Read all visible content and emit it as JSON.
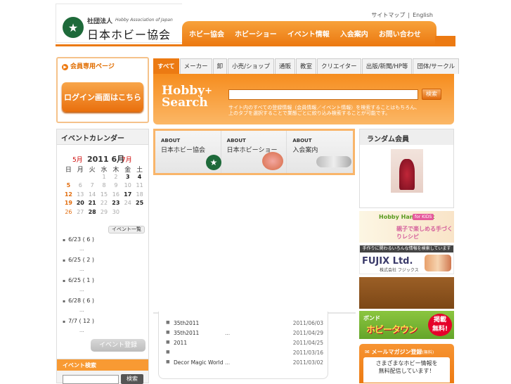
{
  "header": {
    "logo_sub": "社団法人",
    "logo_en": "Hobby Association of Japan",
    "logo_main": "日本ホビー協会",
    "utility": [
      "サイトマップ",
      "English"
    ],
    "nav": [
      "ホビー協会",
      "ホビーショー",
      "イベント情報",
      "入会案内",
      "お問い合わせ"
    ],
    "colors": {
      "accent": "#ec7a12",
      "brand_green": "#1e6a3a"
    }
  },
  "member": {
    "title": "会員専用ページ",
    "login_label": "ログイン画面はこちら"
  },
  "calendar": {
    "title": "イベントカレンダー",
    "prev": "5月",
    "current": "2011 6月",
    "next": "7月",
    "weekday_headers": [
      "日",
      "月",
      "火",
      "水",
      "木",
      "金",
      "土"
    ],
    "weeks": [
      [
        {
          "d": "",
          "s": ""
        },
        {
          "d": "",
          "s": ""
        },
        {
          "d": "",
          "s": ""
        },
        {
          "d": "1",
          "s": "off"
        },
        {
          "d": "2",
          "s": "off"
        },
        {
          "d": "3",
          "s": "on"
        },
        {
          "d": "4",
          "s": "on"
        }
      ],
      [
        {
          "d": "5",
          "s": "sun-on"
        },
        {
          "d": "6",
          "s": "off"
        },
        {
          "d": "7",
          "s": "off"
        },
        {
          "d": "8",
          "s": "off"
        },
        {
          "d": "9",
          "s": "off"
        },
        {
          "d": "10",
          "s": "off"
        },
        {
          "d": "11",
          "s": "off"
        }
      ],
      [
        {
          "d": "12",
          "s": "sun-on"
        },
        {
          "d": "13",
          "s": "off"
        },
        {
          "d": "14",
          "s": "off"
        },
        {
          "d": "15",
          "s": "off"
        },
        {
          "d": "16",
          "s": "off"
        },
        {
          "d": "17",
          "s": "on"
        },
        {
          "d": "18",
          "s": "off"
        }
      ],
      [
        {
          "d": "19",
          "s": "sun-on"
        },
        {
          "d": "20",
          "s": "on"
        },
        {
          "d": "21",
          "s": "on"
        },
        {
          "d": "22",
          "s": "off"
        },
        {
          "d": "23",
          "s": "on"
        },
        {
          "d": "24",
          "s": "off"
        },
        {
          "d": "25",
          "s": "on"
        }
      ],
      [
        {
          "d": "26",
          "s": "sun"
        },
        {
          "d": "27",
          "s": "off"
        },
        {
          "d": "28",
          "s": "on"
        },
        {
          "d": "29",
          "s": "off"
        },
        {
          "d": "30",
          "s": "off"
        },
        {
          "d": "",
          "s": ""
        },
        {
          "d": "",
          "s": ""
        }
      ]
    ],
    "list_button": "イベント一覧",
    "events": [
      {
        "date": "6/23 ( 6 )",
        "extra": "..."
      },
      {
        "date": "6/25 ( 2 )",
        "extra": "..."
      },
      {
        "date": "6/25 ( 1 )",
        "extra": "..."
      },
      {
        "date": "6/28 ( 6 )",
        "extra": "..."
      },
      {
        "date": "7/7 ( 12 )",
        "extra": "..."
      }
    ],
    "register_button": "イベント登録"
  },
  "event_search": {
    "title": "イベント検索",
    "input_value": "",
    "button": "検索"
  },
  "tabs": [
    "すべて",
    "メーカー",
    "卸",
    "小売/ショップ",
    "通販",
    "教室",
    "クリエイター",
    "出版/新聞/HP等",
    "団体/サークル"
  ],
  "hobby_search": {
    "logo1": "Hobby",
    "logo_plus": "+",
    "logo2": "Search",
    "input_value": "",
    "button": "検索",
    "desc1": "サイト内のすべての登録情報（会員情報／イベント情報）を検索することはもちろん、",
    "desc2": "上のタブを選択することで業態ごとに絞り込み検索することが可能です。"
  },
  "about": [
    {
      "t1": "ABOUT",
      "t2": "日本ホビー協会"
    },
    {
      "t1": "ABOUT",
      "t2": "日本ホビーショー"
    },
    {
      "t1": "ABOUT",
      "t2": "入会案内"
    }
  ],
  "news": [
    {
      "title": "35th2011",
      "extra": "",
      "date": "2011/06/03"
    },
    {
      "title": "35th2011",
      "extra": "...",
      "date": "2011/04/29"
    },
    {
      "title": "2011",
      "extra": "",
      "date": "2011/04/25"
    },
    {
      "title": "",
      "extra": "",
      "date": "2011/03/16"
    },
    {
      "title": "Decor Magic World",
      "extra": "...",
      "date": "2011/03/02"
    }
  ],
  "random": {
    "title": "ランダム会員"
  },
  "banners": {
    "hobby_title": "Hobby Handicraft",
    "hobby_kids": "for KIDS",
    "hobby_sub": "親子で楽しめる手づくりレシピ",
    "fujix_top": "手作りに関わるいろんな情報を検索しています",
    "fujix_name": "FUJIX Ltd.",
    "fujix_sub": "株式会社 フジックス",
    "bond_top": "ボンド",
    "bond_main": "ホビータウン",
    "bond_badge1": "掲載",
    "bond_badge2": "無料!",
    "mail_title": "メールマガジン登録",
    "mail_small": "(無料)",
    "mail_desc1": "さまざまなホビー情報を",
    "mail_desc2": "無料配信しています！"
  }
}
